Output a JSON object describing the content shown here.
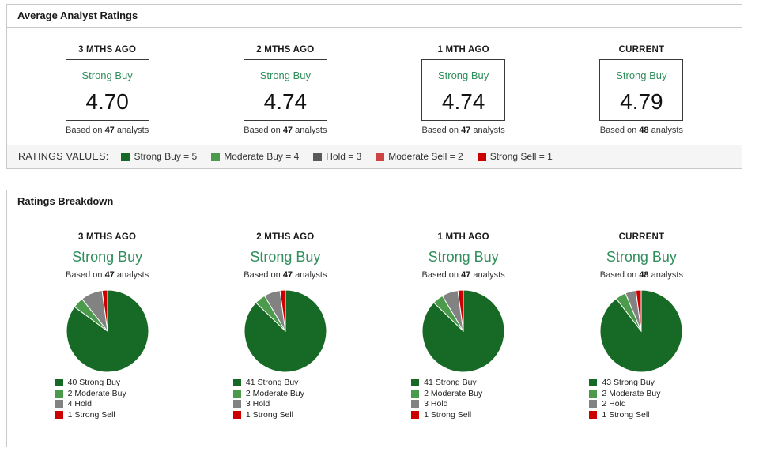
{
  "colors": {
    "strong_buy": "#176a25",
    "moderate_buy": "#4c9b4c",
    "hold_pie": "#828282",
    "hold_legend": "#5a5a5a",
    "moderate_sell": "#cc4444",
    "strong_sell": "#cc0000",
    "rating_text_green": "#2f8e5b",
    "panel_border": "#c9c9c9",
    "values_bar_bg": "#f5f5f5"
  },
  "average_panel": {
    "title": "Average Analyst Ratings",
    "columns": [
      {
        "period": "3 MTHS AGO",
        "rating": "Strong Buy",
        "value": "4.70",
        "based_on": {
          "prefix": "Based on",
          "count": "47",
          "suffix": "analysts"
        }
      },
      {
        "period": "2 MTHS AGO",
        "rating": "Strong Buy",
        "value": "4.74",
        "based_on": {
          "prefix": "Based on",
          "count": "47",
          "suffix": "analysts"
        }
      },
      {
        "period": "1 MTH AGO",
        "rating": "Strong Buy",
        "value": "4.74",
        "based_on": {
          "prefix": "Based on",
          "count": "47",
          "suffix": "analysts"
        }
      },
      {
        "period": "CURRENT",
        "rating": "Strong Buy",
        "value": "4.79",
        "based_on": {
          "prefix": "Based on",
          "count": "48",
          "suffix": "analysts"
        }
      }
    ],
    "ratings_values_legend": {
      "label": "RATINGS VALUES:",
      "items": [
        {
          "label": "Strong Buy = 5",
          "color": "#176a25"
        },
        {
          "label": "Moderate Buy = 4",
          "color": "#4c9b4c"
        },
        {
          "label": "Hold = 3",
          "color": "#5a5a5a"
        },
        {
          "label": "Moderate Sell = 2",
          "color": "#cc4444"
        },
        {
          "label": "Strong Sell = 1",
          "color": "#cc0000"
        }
      ]
    }
  },
  "breakdown_panel": {
    "title": "Ratings Breakdown"
  },
  "chart_data": [
    {
      "type": "pie",
      "period": "3 MTHS AGO",
      "rating": "Strong Buy",
      "based_on": {
        "prefix": "Based on",
        "count": "47",
        "suffix": "analysts"
      },
      "start_angle_deg": -90,
      "direction": "clockwise",
      "legend_position": "bottom",
      "slices": [
        {
          "label": "40 Strong Buy",
          "value": 40,
          "color": "#176a25"
        },
        {
          "label": "2 Moderate Buy",
          "value": 2,
          "color": "#4c9b4c"
        },
        {
          "label": "4 Hold",
          "value": 4,
          "color": "#828282"
        },
        {
          "label": "1 Strong Sell",
          "value": 1,
          "color": "#cc0000"
        }
      ]
    },
    {
      "type": "pie",
      "period": "2 MTHS AGO",
      "rating": "Strong Buy",
      "based_on": {
        "prefix": "Based on",
        "count": "47",
        "suffix": "analysts"
      },
      "start_angle_deg": -90,
      "direction": "clockwise",
      "legend_position": "bottom",
      "slices": [
        {
          "label": "41 Strong Buy",
          "value": 41,
          "color": "#176a25"
        },
        {
          "label": "2 Moderate Buy",
          "value": 2,
          "color": "#4c9b4c"
        },
        {
          "label": "3 Hold",
          "value": 3,
          "color": "#828282"
        },
        {
          "label": "1 Strong Sell",
          "value": 1,
          "color": "#cc0000"
        }
      ]
    },
    {
      "type": "pie",
      "period": "1 MTH AGO",
      "rating": "Strong Buy",
      "based_on": {
        "prefix": "Based on",
        "count": "47",
        "suffix": "analysts"
      },
      "start_angle_deg": -90,
      "direction": "clockwise",
      "legend_position": "bottom",
      "slices": [
        {
          "label": "41 Strong Buy",
          "value": 41,
          "color": "#176a25"
        },
        {
          "label": "2 Moderate Buy",
          "value": 2,
          "color": "#4c9b4c"
        },
        {
          "label": "3 Hold",
          "value": 3,
          "color": "#828282"
        },
        {
          "label": "1 Strong Sell",
          "value": 1,
          "color": "#cc0000"
        }
      ]
    },
    {
      "type": "pie",
      "period": "CURRENT",
      "rating": "Strong Buy",
      "based_on": {
        "prefix": "Based on",
        "count": "48",
        "suffix": "analysts"
      },
      "start_angle_deg": -90,
      "direction": "clockwise",
      "legend_position": "bottom",
      "slices": [
        {
          "label": "43 Strong Buy",
          "value": 43,
          "color": "#176a25"
        },
        {
          "label": "2 Moderate Buy",
          "value": 2,
          "color": "#4c9b4c"
        },
        {
          "label": "2 Hold",
          "value": 2,
          "color": "#828282"
        },
        {
          "label": "1 Strong Sell",
          "value": 1,
          "color": "#cc0000"
        }
      ]
    }
  ]
}
